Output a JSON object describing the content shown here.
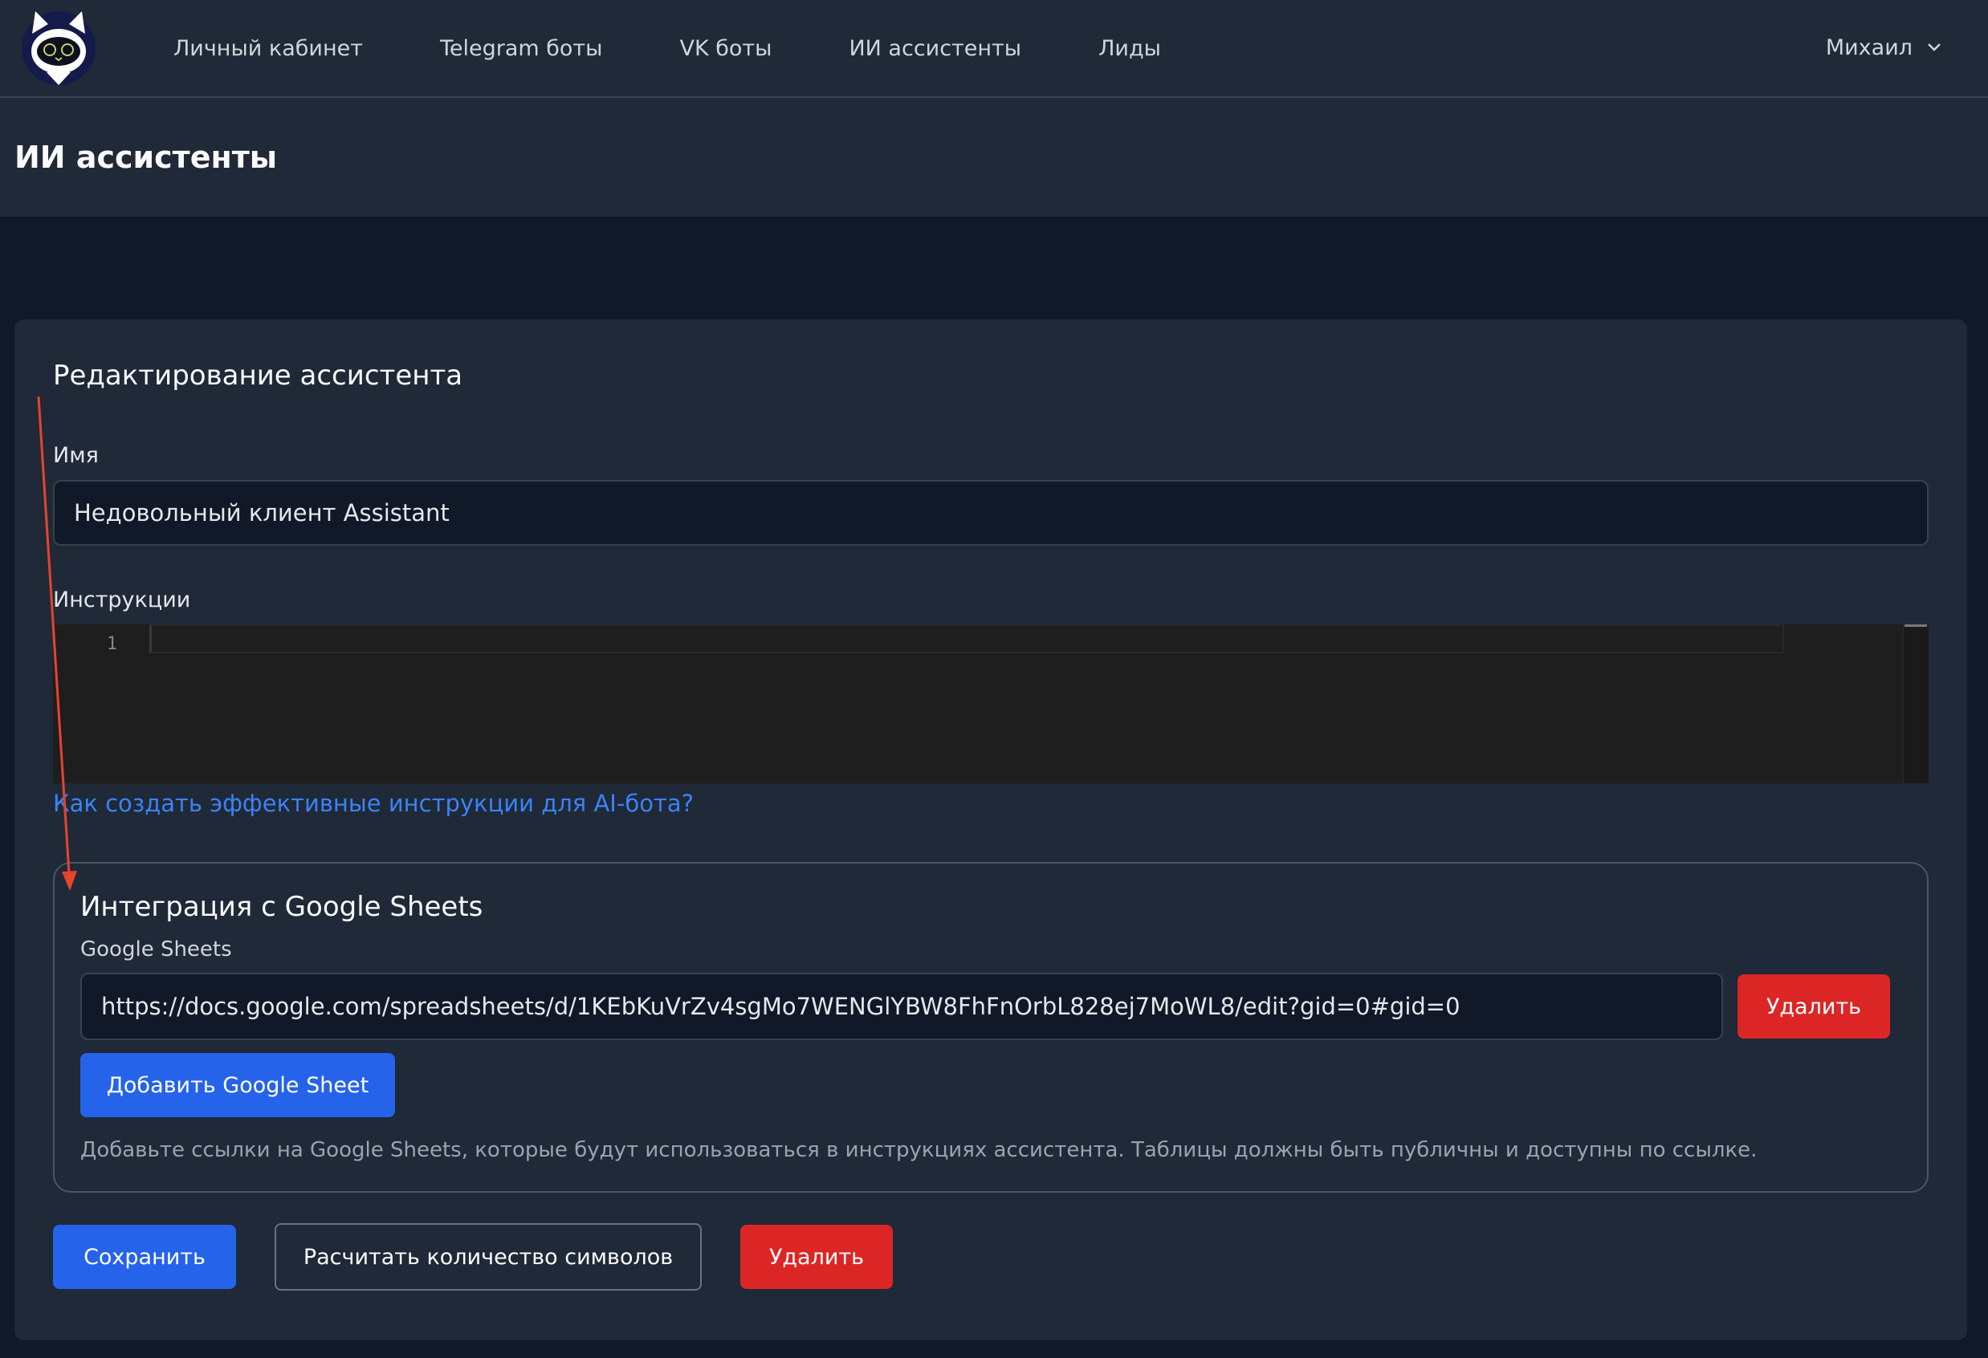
{
  "nav": {
    "links": [
      "Личный кабинет",
      "Telegram боты",
      "VK боты",
      "ИИ ассистенты",
      "Лиды"
    ],
    "user_name": "Михаил"
  },
  "page": {
    "title": "ИИ ассистенты"
  },
  "form": {
    "title": "Редактирование ассистента",
    "name_label": "Имя",
    "name_value": "Недовольный клиент Assistant",
    "instructions_label": "Инструкции",
    "editor_line_number": "1",
    "help_link": "Как создать эффективные инструкции для AI-бота?",
    "google_sheets": {
      "title": "Интеграция с Google Sheets",
      "label": "Google Sheets",
      "url_value": "https://docs.google.com/spreadsheets/d/1KEbKuVrZv4sgMo7WENGlYBW8FhFnOrbL828ej7MoWL8/edit?gid=0#gid=0",
      "remove_label": "Удалить",
      "add_label": "Добавить Google Sheet",
      "hint": "Добавьте ссылки на Google Sheets, которые будут использоваться в инструкциях ассистента. Таблицы должны быть публичны и доступны по ссылке."
    },
    "actions": {
      "save_label": "Сохранить",
      "count_label": "Расчитать количество символов",
      "delete_label": "Удалить"
    }
  },
  "colors": {
    "background": "#111827",
    "panel": "#1f2937",
    "primary": "#2563eb",
    "danger": "#dc2626",
    "link": "#3b82f6",
    "annotation_arrow": "#e8432e"
  },
  "icons": {
    "logo": "cat-astronaut-logo",
    "user_menu": "chevron-down-icon",
    "annotation": "red-arrow"
  }
}
